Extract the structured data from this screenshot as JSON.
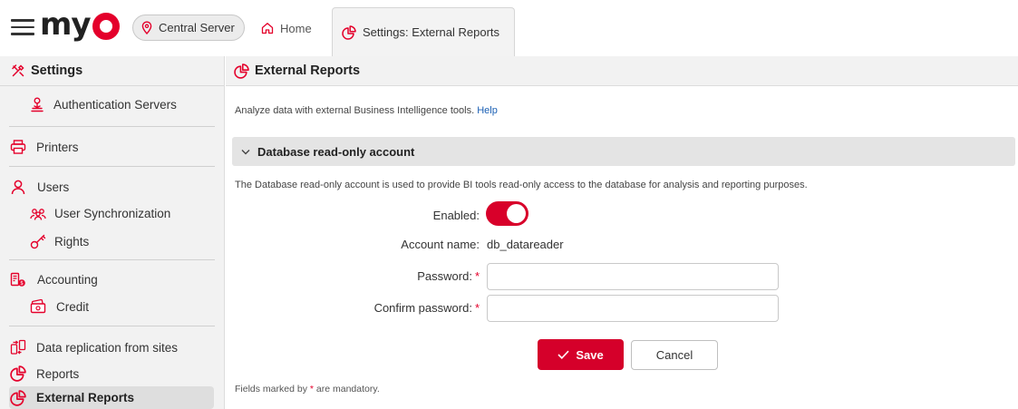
{
  "header": {
    "menu_icon": "hamburger-menu-icon",
    "logo_text": "my",
    "server_label": "Central Server",
    "tabs": [
      {
        "label": "Home",
        "icon": "home-icon"
      },
      {
        "label": "Settings: External Reports",
        "icon": "pie-chart-icon"
      }
    ]
  },
  "sidebar": {
    "title": "Settings",
    "items": [
      {
        "label": "Authentication Servers",
        "icon": "auth-server-icon"
      },
      {
        "label": "Printers",
        "icon": "printer-icon"
      },
      {
        "label": "Users",
        "icon": "user-icon"
      },
      {
        "label": "User Synchronization",
        "icon": "user-sync-icon"
      },
      {
        "label": "Rights",
        "icon": "key-icon"
      },
      {
        "label": "Accounting",
        "icon": "accounting-icon"
      },
      {
        "label": "Credit",
        "icon": "credit-icon"
      },
      {
        "label": "Data replication from sites",
        "icon": "replication-icon"
      },
      {
        "label": "Reports",
        "icon": "pie-chart-icon"
      },
      {
        "label": "External Reports",
        "icon": "pie-chart-icon"
      }
    ]
  },
  "main": {
    "title": "External Reports",
    "subtitle": "Analyze data with external Business Intelligence tools.",
    "help_link": "Help",
    "section": {
      "title": "Database read-only account",
      "description": "The Database read-only account is used to provide BI tools read-only access to the database for analysis and reporting purposes."
    },
    "form": {
      "enabled_label": "Enabled:",
      "enabled": true,
      "account_label": "Account name:",
      "account_value": "db_datareader",
      "password_label": "Password:",
      "password_value": "",
      "confirm_label": "Confirm password:",
      "confirm_value": "",
      "required_mark": "*"
    },
    "buttons": {
      "save": "Save",
      "cancel": "Cancel"
    },
    "footnote": {
      "before": "Fields marked by",
      "mark": "*",
      "after": "are mandatory."
    }
  },
  "colors": {
    "accent": "#d5002a",
    "link": "#1a5fb4"
  }
}
